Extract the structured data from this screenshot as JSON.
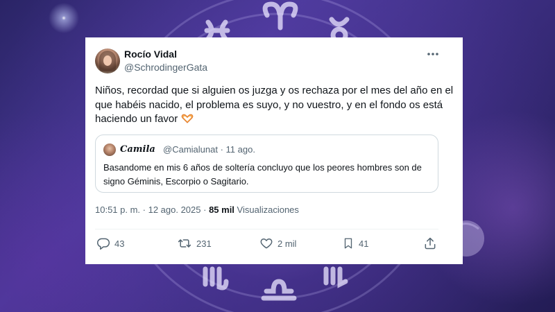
{
  "colors": {
    "text_primary": "#0f1419",
    "text_secondary": "#536471",
    "border": "#cfd9de",
    "card_background": "#ffffff"
  },
  "tweet": {
    "author_name": "Rocío Vidal",
    "author_handle": "@SchrodingerGata",
    "more_icon": "more-dots-icon",
    "text": "Niños, recordad que si alguien os juzga y os rechaza por el mes del año en el que habéis nacido, el problema es suyo, y no vuestro, y en el fondo os está haciendo un favor",
    "emoji": "heart-hands-icon",
    "quoted": {
      "author_name": "Camila",
      "author_handle": "@Camialunat",
      "date": "· 11 ago.",
      "text": "Basandome en mis 6 años de soltería concluyo que los peores hombres son de signo Géminis, Escorpio o Sagitario."
    },
    "timestamp": "10:51 p. m. · 12 ago. 2025 ·",
    "views_count": "85 mil",
    "views_label": "Visualizaciones",
    "actions": {
      "replies": "43",
      "retweets": "231",
      "likes": "2 mil",
      "bookmarks": "41"
    }
  }
}
